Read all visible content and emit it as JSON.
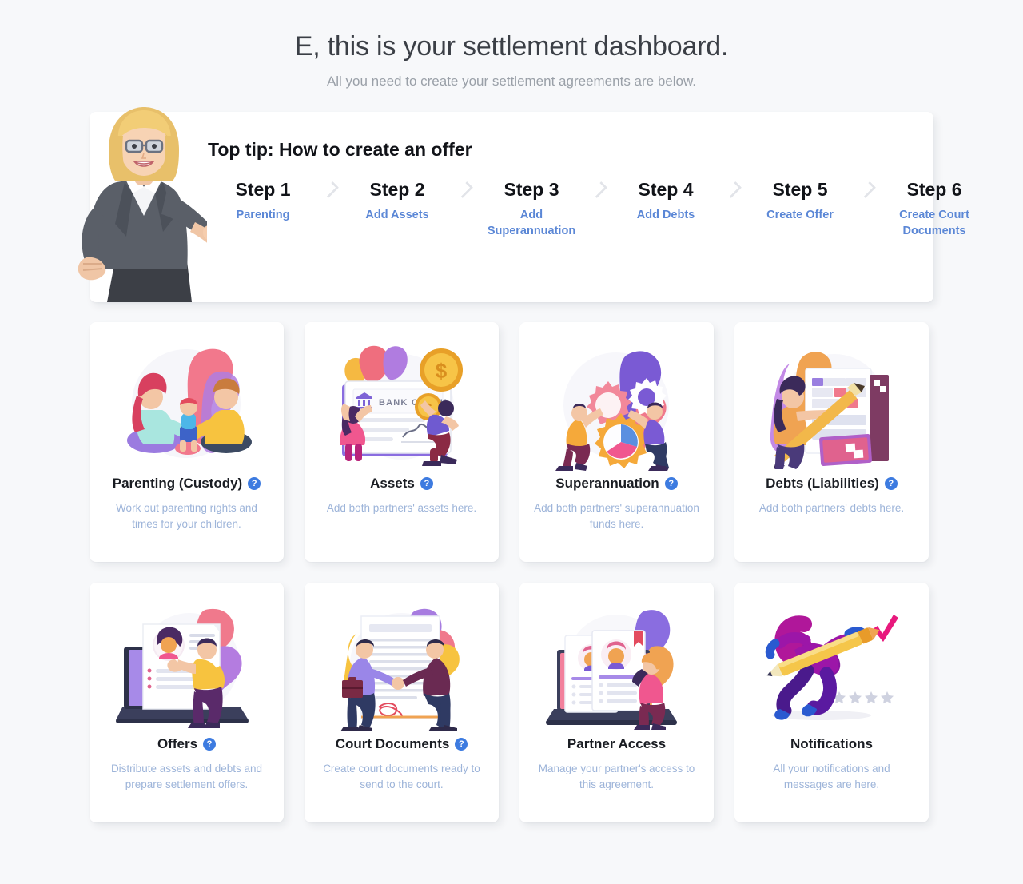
{
  "hero": {
    "title": "E, this is your settlement dashboard.",
    "subtitle": "All you need to create your settlement agreements are below."
  },
  "tip": {
    "heading": "Top tip: How to create an offer",
    "avatar_icon": "businesswoman-pointing-illustration",
    "separator_icon": "chevron-right-icon",
    "steps": [
      {
        "number": "Step 1",
        "label": "Parenting"
      },
      {
        "number": "Step 2",
        "label": "Add Assets"
      },
      {
        "number": "Step 3",
        "label": "Add Superannuation"
      },
      {
        "number": "Step 4",
        "label": "Add Debts"
      },
      {
        "number": "Step 5",
        "label": "Create Offer"
      },
      {
        "number": "Step 6",
        "label": "Create Court Documents"
      }
    ]
  },
  "cards": [
    {
      "key": "parenting",
      "title": "Parenting (Custody)",
      "description": "Work out parenting rights and times for your children.",
      "has_help": true,
      "help_icon": "question-mark-circle-icon",
      "art_icon": "family-parenting-illustration"
    },
    {
      "key": "assets",
      "title": "Assets",
      "description": "Add both partners' assets here.",
      "has_help": true,
      "help_icon": "question-mark-circle-icon",
      "art_icon": "bank-check-money-illustration",
      "art_text": "BANK CHECK"
    },
    {
      "key": "superannuation",
      "title": "Superannuation",
      "description": "Add both partners' superannuation funds here.",
      "has_help": true,
      "help_icon": "question-mark-circle-icon",
      "art_icon": "gears-cogs-illustration"
    },
    {
      "key": "debts",
      "title": "Debts (Liabilities)",
      "description": "Add both partners' debts here.",
      "has_help": true,
      "help_icon": "question-mark-circle-icon",
      "art_icon": "person-document-chart-illustration"
    },
    {
      "key": "offers",
      "title": "Offers",
      "description": "Distribute assets and debts and prepare settlement offers.",
      "has_help": true,
      "help_icon": "question-mark-circle-icon",
      "art_icon": "laptop-profile-review-illustration"
    },
    {
      "key": "court-documents",
      "title": "Court Documents",
      "description": "Create court documents ready to send to the court.",
      "has_help": true,
      "help_icon": "question-mark-circle-icon",
      "art_icon": "handshake-contract-illustration"
    },
    {
      "key": "partner-access",
      "title": "Partner Access",
      "description": "Manage your partner's access to this agreement.",
      "has_help": false,
      "help_icon": "question-mark-circle-icon",
      "art_icon": "profile-cards-laptop-illustration"
    },
    {
      "key": "notifications",
      "title": "Notifications",
      "description": "All your notifications and messages are here.",
      "has_help": false,
      "help_icon": "question-mark-circle-icon",
      "art_icon": "person-running-pencil-illustration"
    }
  ],
  "help_glyph": "?",
  "colors": {
    "page_background": "#f7f8fa",
    "card_background": "#ffffff",
    "title_text": "#3b3f46",
    "subtitle_text": "#9aa0a8",
    "step_link": "#5b87d6",
    "card_description": "#9db4d9",
    "help_badge": "#3d7be0",
    "chevron": "#e2e4e9"
  }
}
